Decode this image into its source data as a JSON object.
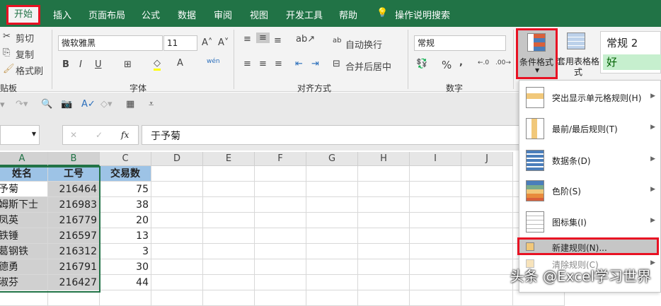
{
  "tabs": [
    "开始",
    "插入",
    "页面布局",
    "公式",
    "数据",
    "审阅",
    "视图",
    "开发工具",
    "帮助"
  ],
  "tell_me": "操作说明搜索",
  "clipboard": {
    "cut": "剪切",
    "copy": "复制",
    "format_painter": "格式刷",
    "group": "贴板"
  },
  "font": {
    "name": "微软雅黑",
    "size": "11",
    "group": "字体",
    "bold": "B",
    "italic": "I",
    "underline": "U",
    "phonetic": "wén"
  },
  "alignment": {
    "wrap": "自动换行",
    "merge": "合并后居中",
    "group": "对齐方式"
  },
  "number": {
    "format": "常规",
    "percent": "%",
    "comma": ",",
    "group": "数字"
  },
  "styles": {
    "conditional": "条件格式",
    "table_format": "套用表格格式",
    "style1": "常规 2",
    "style2": "好"
  },
  "formula_bar": {
    "fx": "fx",
    "value": "于予菊"
  },
  "columns": [
    "A",
    "B",
    "C",
    "D",
    "E",
    "F",
    "G",
    "H",
    "I",
    "J"
  ],
  "table": {
    "headers": [
      "姓名",
      "工号",
      "交易数"
    ],
    "rows": [
      [
        "予菊",
        "216464",
        "75"
      ],
      [
        "姆斯下士",
        "216983",
        "38"
      ],
      [
        "凤英",
        "216779",
        "20"
      ],
      [
        "铁锤",
        "216597",
        "13"
      ],
      [
        "葛钢铁",
        "216312",
        "3"
      ],
      [
        "德勇",
        "216791",
        "30"
      ],
      [
        "淑芬",
        "216427",
        "44"
      ]
    ]
  },
  "menu": [
    {
      "label": "突出显示单元格规则(H)",
      "icon": "highlight-rules-icon"
    },
    {
      "label": "最前/最后规则(T)",
      "icon": "top-bottom-icon"
    },
    {
      "label": "数据条(D)",
      "icon": "data-bars-icon"
    },
    {
      "label": "色阶(S)",
      "icon": "color-scales-icon"
    },
    {
      "label": "图标集(I)",
      "icon": "icon-sets-icon"
    },
    {
      "label": "新建规则(N)...",
      "icon": "new-rule-icon"
    },
    {
      "label": "清除规则(C)",
      "icon": "clear-rules-icon"
    }
  ],
  "watermark": "头条 @Excel学习世界",
  "colors": {
    "brand": "#217346",
    "highlight": "#e81123",
    "header_fill": "#9dc3e6"
  }
}
